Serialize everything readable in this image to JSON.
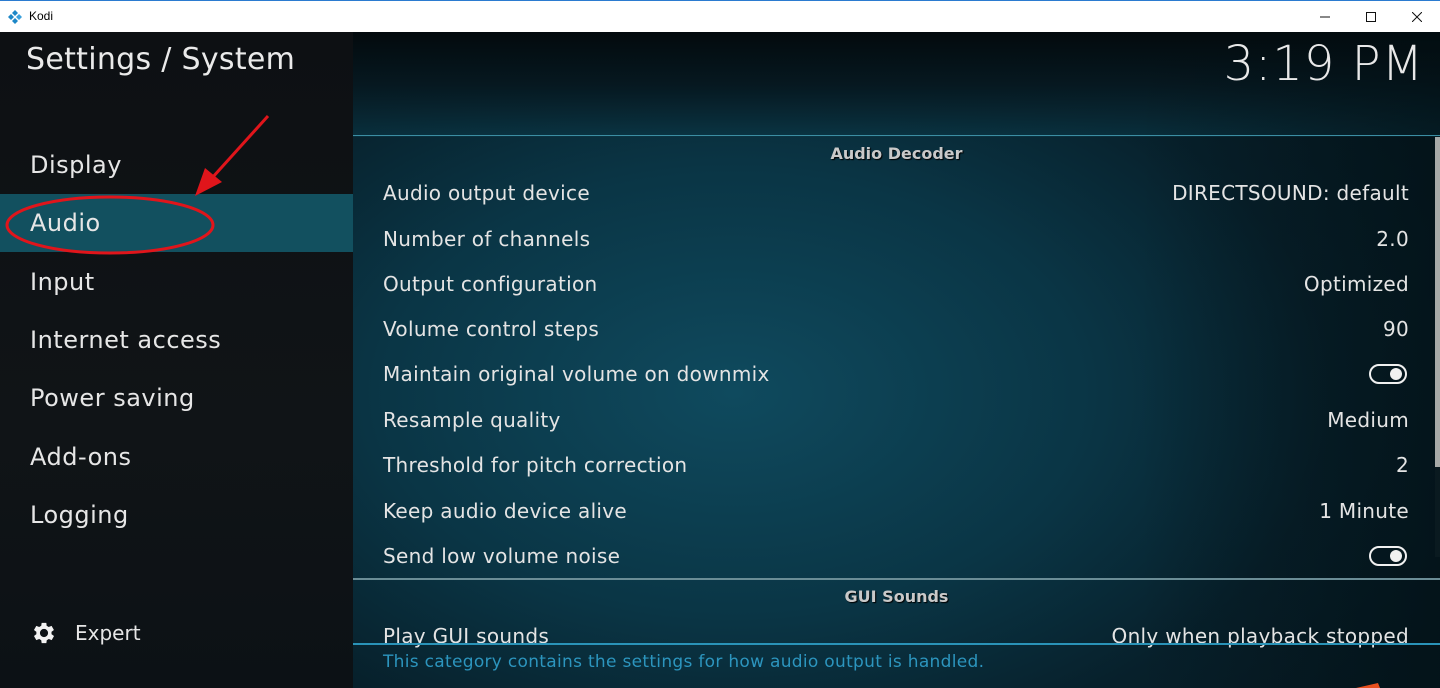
{
  "window": {
    "title": "Kodi",
    "controls": {
      "minimize": "minimize",
      "maximize": "maximize",
      "close": "close"
    }
  },
  "sidebar": {
    "title": "Settings / System",
    "items": [
      {
        "label": "Display"
      },
      {
        "label": "Audio",
        "active": true
      },
      {
        "label": "Input"
      },
      {
        "label": "Internet access"
      },
      {
        "label": "Power saving"
      },
      {
        "label": "Add-ons"
      },
      {
        "label": "Logging"
      }
    ],
    "expert": {
      "label": "Expert",
      "icon": "gear-icon"
    }
  },
  "header": {
    "clock": "3:19 PM"
  },
  "sections": [
    {
      "title": "Audio Decoder",
      "settings": [
        {
          "label": "Audio output device",
          "value": "DIRECTSOUND: default"
        },
        {
          "label": "Number of channels",
          "value": "2.0"
        },
        {
          "label": "Output configuration",
          "value": "Optimized"
        },
        {
          "label": "Volume control steps",
          "value": "90"
        },
        {
          "label": "Maintain original volume on downmix",
          "toggle": true
        },
        {
          "label": "Resample quality",
          "value": "Medium"
        },
        {
          "label": "Threshold for pitch correction",
          "value": "2"
        },
        {
          "label": "Keep audio device alive",
          "value": "1 Minute"
        },
        {
          "label": "Send low volume noise",
          "toggle": true
        }
      ]
    },
    {
      "title": "GUI Sounds",
      "settings": [
        {
          "label": "Play GUI sounds",
          "value": "Only when playback stopped"
        }
      ]
    }
  ],
  "description": "This category contains the settings for how audio output is handled.",
  "colors": {
    "accent": "#12505f",
    "description_text": "#2c95be",
    "annotation": "#e0151b"
  }
}
